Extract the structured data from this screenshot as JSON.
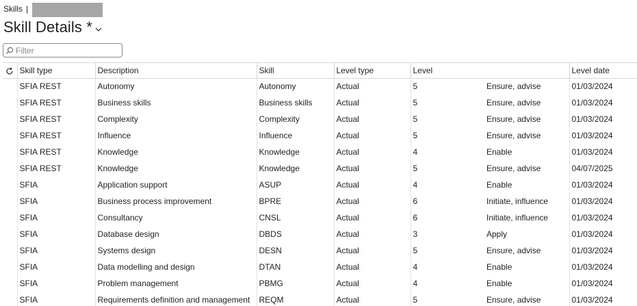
{
  "breadcrumb": {
    "root": "Skills",
    "separator": "|"
  },
  "page": {
    "title": "Skill Details *"
  },
  "filter": {
    "placeholder": "Filter"
  },
  "columns": {
    "skill_type": "Skill type",
    "description": "Description",
    "skill": "Skill",
    "level_type": "Level type",
    "level": "Level",
    "level_date": "Level date"
  },
  "rows": [
    {
      "skill_type": "SFIA REST",
      "description": "Autonomy",
      "skill": "Autonomy",
      "level_type": "Actual",
      "level": "5",
      "level_name": "Ensure, advise",
      "level_date": "01/03/2024"
    },
    {
      "skill_type": "SFIA REST",
      "description": "Business skills",
      "skill": "Business skills",
      "level_type": "Actual",
      "level": "5",
      "level_name": "Ensure, advise",
      "level_date": "01/03/2024"
    },
    {
      "skill_type": "SFIA REST",
      "description": "Complexity",
      "skill": "Complexity",
      "level_type": "Actual",
      "level": "5",
      "level_name": "Ensure, advise",
      "level_date": "01/03/2024"
    },
    {
      "skill_type": "SFIA REST",
      "description": "Influence",
      "skill": "Influence",
      "level_type": "Actual",
      "level": "5",
      "level_name": "Ensure, advise",
      "level_date": "01/03/2024"
    },
    {
      "skill_type": "SFIA REST",
      "description": "Knowledge",
      "skill": "Knowledge",
      "level_type": "Actual",
      "level": "4",
      "level_name": "Enable",
      "level_date": "01/03/2024"
    },
    {
      "skill_type": "SFIA REST",
      "description": "Knowledge",
      "skill": "Knowledge",
      "level_type": "Actual",
      "level": "5",
      "level_name": "Ensure, advise",
      "level_date": "04/07/2025"
    },
    {
      "skill_type": "SFIA",
      "description": "Application support",
      "skill": "ASUP",
      "level_type": "Actual",
      "level": "4",
      "level_name": "Enable",
      "level_date": "01/03/2024"
    },
    {
      "skill_type": "SFIA",
      "description": "Business process improvement",
      "skill": "BPRE",
      "level_type": "Actual",
      "level": "6",
      "level_name": "Initiate, influence",
      "level_date": "01/03/2024"
    },
    {
      "skill_type": "SFIA",
      "description": "Consultancy",
      "skill": "CNSL",
      "level_type": "Actual",
      "level": "6",
      "level_name": "Initiate, influence",
      "level_date": "01/03/2024"
    },
    {
      "skill_type": "SFIA",
      "description": "Database design",
      "skill": "DBDS",
      "level_type": "Actual",
      "level": "3",
      "level_name": "Apply",
      "level_date": "01/03/2024"
    },
    {
      "skill_type": "SFIA",
      "description": "Systems design",
      "skill": "DESN",
      "level_type": "Actual",
      "level": "5",
      "level_name": "Ensure, advise",
      "level_date": "01/03/2024"
    },
    {
      "skill_type": "SFIA",
      "description": "Data modelling and design",
      "skill": "DTAN",
      "level_type": "Actual",
      "level": "4",
      "level_name": "Enable",
      "level_date": "01/03/2024"
    },
    {
      "skill_type": "SFIA",
      "description": "Problem management",
      "skill": "PBMG",
      "level_type": "Actual",
      "level": "4",
      "level_name": "Enable",
      "level_date": "01/03/2024"
    },
    {
      "skill_type": "SFIA",
      "description": "Requirements definition and management",
      "skill": "REQM",
      "level_type": "Actual",
      "level": "5",
      "level_name": "Ensure, advise",
      "level_date": "01/03/2024"
    }
  ],
  "icons": {
    "title_dropdown": "chevron-down-icon",
    "filter": "search-icon",
    "refresh": "refresh-icon"
  },
  "colors": {
    "text": "#1f1f1f",
    "border": "#d6d6d6",
    "redaction": "#a6a6a6"
  }
}
